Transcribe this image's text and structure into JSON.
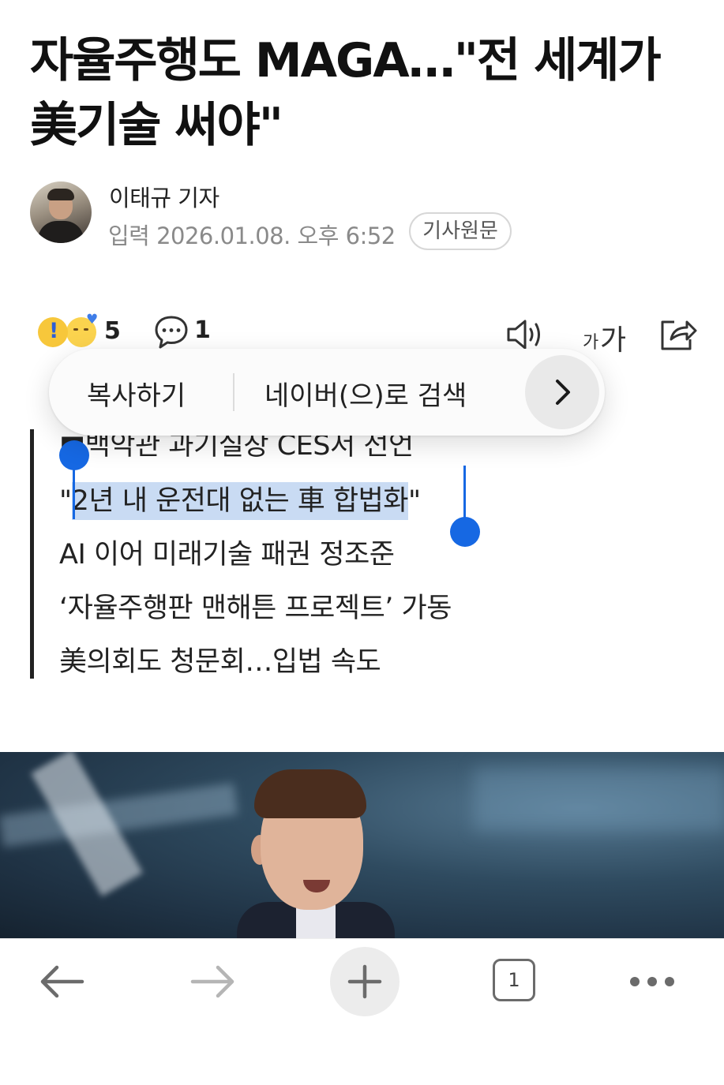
{
  "article": {
    "title_line1": "자율주행도 MAGA…\"전 세계가",
    "title_line2": "美기술 써야\"",
    "author": "이태규 기자",
    "date": "입력 2026.01.08. 오후 6:52",
    "original_button": "기사원문"
  },
  "toolbar": {
    "reaction_count": "5",
    "comment_count": "1",
    "font_small": "가",
    "font_big": "가"
  },
  "context_menu": {
    "copy_label": "복사하기",
    "search_label": "네이버(으)로 검색"
  },
  "summary": {
    "line1": "■백악관 과기실장 CES서 선언",
    "line2_open": "\"",
    "line2_selected": "2년 내 운전대 없는 車 합법화",
    "line2_close": "\"",
    "line3": "AI 이어 미래기술 패권 정조준",
    "line4": "‘자율주행판 맨해튼 프로젝트’ 가동",
    "line5": "美의회도 청문회…입법 속도"
  },
  "browser": {
    "tab_count": "1"
  },
  "colors": {
    "selection_highlight": "#c9dbf3",
    "selection_handle": "#1668e3"
  },
  "icons": [
    "reaction-emoji-icon",
    "comment-icon",
    "speaker-icon",
    "font-size-icon",
    "share-icon",
    "chevron-right-icon",
    "back-arrow-icon",
    "forward-arrow-icon",
    "plus-icon",
    "tabs-icon",
    "more-icon"
  ]
}
